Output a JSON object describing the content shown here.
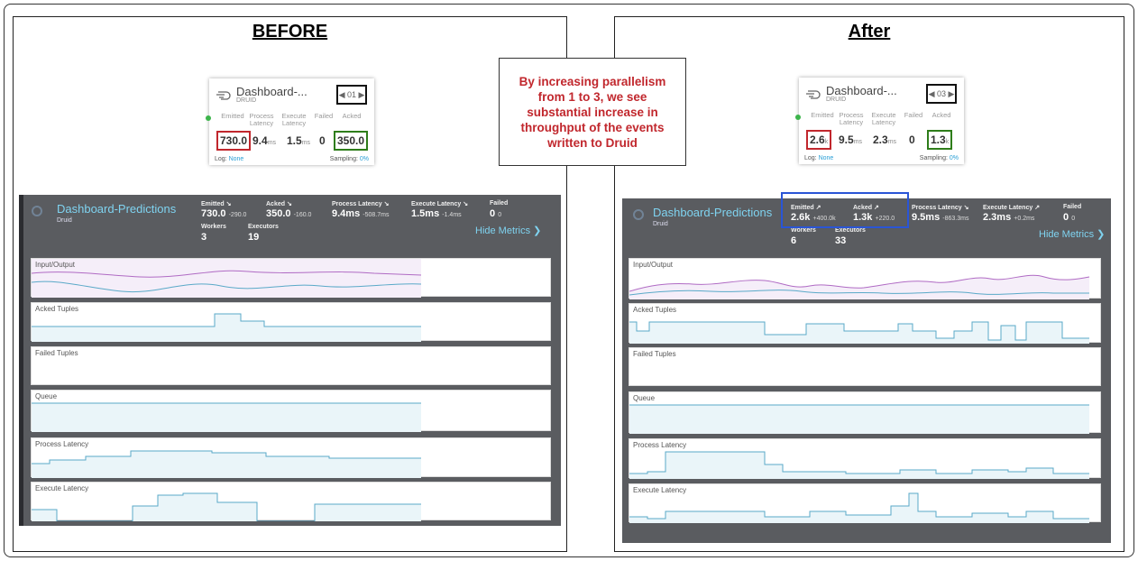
{
  "panels": {
    "before": {
      "heading": "BEFORE",
      "card": {
        "title": "Dashboard-...",
        "subtitle": "DRUID",
        "pager": "◀ 01 ▶",
        "cols": [
          "Emitted",
          "Process Latency",
          "Execute Latency",
          "Failed",
          "Acked"
        ],
        "emitted": "730.0",
        "process_latency": "9.4",
        "process_unit": "ms",
        "execute_latency": "1.5",
        "execute_unit": "ms",
        "failed": "0",
        "acked": "350.0",
        "log_label": "Log:",
        "log_value": "None",
        "sampling_label": "Sampling:",
        "sampling_value": "0%"
      },
      "dashboard": {
        "title": "Dashboard-Predictions",
        "subtitle": "Druid",
        "metrics": [
          {
            "label": "Emitted ↘",
            "value": "730.0",
            "delta": "-290.0"
          },
          {
            "label": "Acked ↘",
            "value": "350.0",
            "delta": "-160.0"
          },
          {
            "label": "Process Latency ↘",
            "value": "9.4ms",
            "delta": "-508.7ms"
          },
          {
            "label": "Execute Latency ↘",
            "value": "1.5ms",
            "delta": "-1.4ms"
          },
          {
            "label": "Failed",
            "value": "0",
            "delta": "0"
          }
        ],
        "workers_label": "Workers",
        "workers": "3",
        "executors_label": "Executors",
        "executors": "19",
        "hide_metrics": "Hide Metrics ❯",
        "charts": [
          "Input/Output",
          "Acked Tuples",
          "Failed Tuples",
          "Queue",
          "Process Latency",
          "Execute Latency"
        ]
      }
    },
    "after": {
      "heading": "After",
      "card": {
        "title": "Dashboard-...",
        "subtitle": "DRUID",
        "pager": "◀ 03 ▶",
        "cols": [
          "Emitted",
          "Process Latency",
          "Execute Latency",
          "Failed",
          "Acked"
        ],
        "emitted": "2.6",
        "emitted_unit": "k",
        "process_latency": "9.5",
        "process_unit": "ms",
        "execute_latency": "2.3",
        "execute_unit": "ms",
        "failed": "0",
        "acked": "1.3",
        "acked_unit": "k",
        "log_label": "Log:",
        "log_value": "None",
        "sampling_label": "Sampling:",
        "sampling_value": "0%"
      },
      "dashboard": {
        "title": "Dashboard-Predictions",
        "subtitle": "Druid",
        "metrics": [
          {
            "label": "Emitted ↗",
            "value": "2.6k",
            "delta": "+400.0k"
          },
          {
            "label": "Acked ↗",
            "value": "1.3k",
            "delta": "+220.0"
          },
          {
            "label": "Process Latency ↘",
            "value": "9.5ms",
            "delta": "-863.3ms"
          },
          {
            "label": "Execute Latency ↗",
            "value": "2.3ms",
            "delta": "+0.2ms"
          },
          {
            "label": "Failed",
            "value": "0",
            "delta": "0"
          }
        ],
        "workers_label": "Workers",
        "workers": "6",
        "executors_label": "Executors",
        "executors": "33",
        "hide_metrics": "Hide Metrics ❯",
        "charts": [
          "Input/Output",
          "Acked Tuples",
          "Failed Tuples",
          "Queue",
          "Process Latency",
          "Execute Latency"
        ]
      }
    }
  },
  "callout": "By increasing parallelism from 1 to 3, we see substantial increase in throughput of the events written to Druid",
  "colors": {
    "callout_text": "#c1272d",
    "dashboard_bg": "#5a5c60",
    "accent": "#7fd3f0",
    "emitted_box": "#c1272d",
    "acked_box": "#2e7d1a",
    "highlight_box": "#2a55d6"
  }
}
